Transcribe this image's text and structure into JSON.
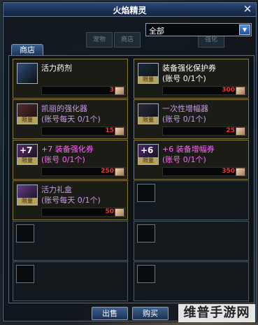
{
  "window": {
    "title": "火焰精灵",
    "close_glyph": "✕"
  },
  "filter": {
    "selected": "全部",
    "arrow_glyph": "▼"
  },
  "bg_tabs": [
    "宠物",
    "商店",
    "强化"
  ],
  "tabs": [
    {
      "label": "商店"
    }
  ],
  "items": [
    {
      "name": "活力药剂",
      "subtitle": "",
      "price": "3",
      "limited": false,
      "name_color": "#ffffff",
      "icon_color": "#2c4f78",
      "icon_mark": ""
    },
    {
      "name": "装备强化保护券",
      "subtitle": "(账号 0/1个)",
      "price": "300",
      "limited": true,
      "name_color": "#ffffff",
      "icon_color": "#1c2a3a",
      "icon_mark": ""
    },
    {
      "name": "凯丽的强化器",
      "subtitle": "(账号每天 0/1个)",
      "price": "15",
      "limited": true,
      "name_color": "#c59ae8",
      "icon_color": "#5a2a2a",
      "icon_mark": ""
    },
    {
      "name": "一次性增幅器",
      "subtitle": "(账号 0/1个)",
      "price": "25",
      "limited": true,
      "name_color": "#c59ae8",
      "icon_color": "#2a2a3a",
      "icon_mark": ""
    },
    {
      "name": "+7 装备强化券",
      "subtitle": "(账号 0/1个)",
      "price": "250",
      "limited": true,
      "name_color": "#ff66ff",
      "icon_color": "#5a2a6a",
      "icon_mark": "+7"
    },
    {
      "name": "+6 装备增幅券",
      "subtitle": "(账号 0/1个)",
      "price": "350",
      "limited": true,
      "name_color": "#ff66ff",
      "icon_color": "#4a2a6a",
      "icon_mark": "+6"
    },
    {
      "name": "活力礼盒",
      "subtitle": "(账号每天 0/1个)",
      "price": "50",
      "limited": true,
      "name_color": "#c59ae8",
      "icon_color": "#6a3a8a",
      "icon_mark": ""
    }
  ],
  "limit_label": "限量",
  "empty_slot_count": 5,
  "buttons": {
    "sell": "出售",
    "buy": "购买"
  },
  "watermark": "维普手游网"
}
